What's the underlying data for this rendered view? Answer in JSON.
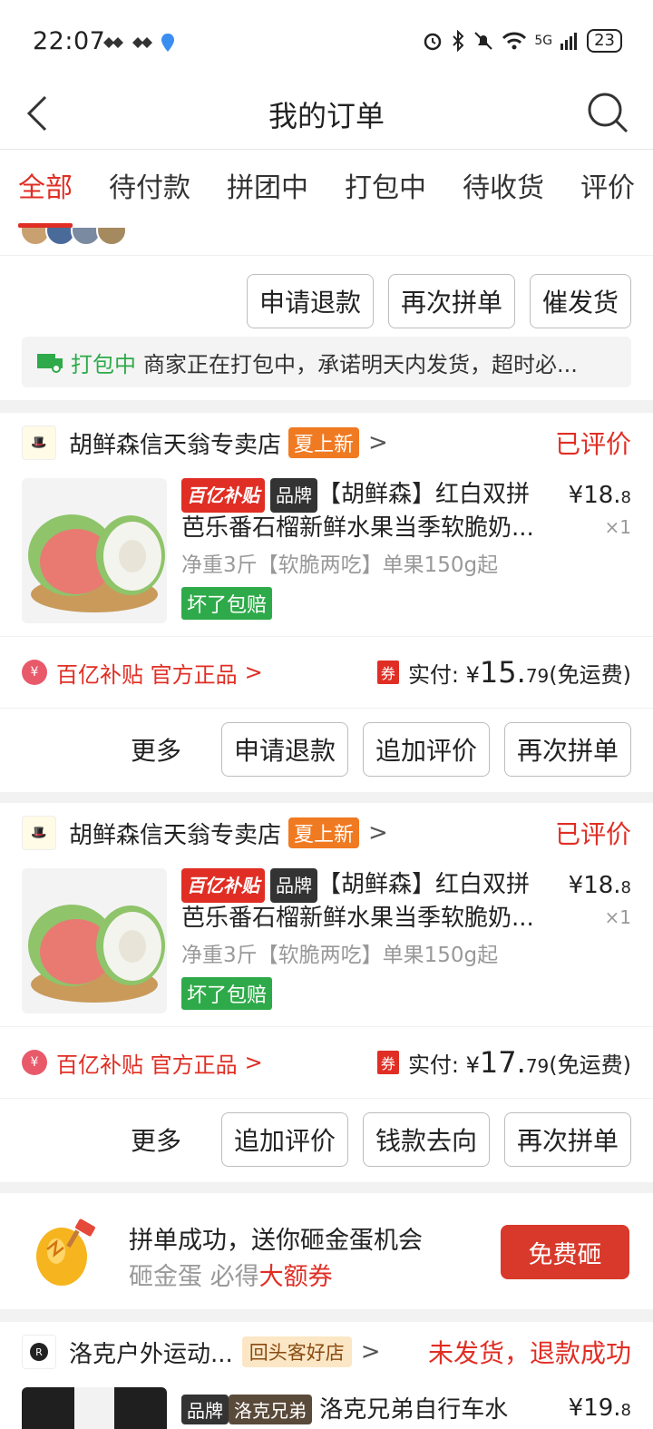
{
  "status_bar": {
    "time": "22:07",
    "network": "5G",
    "battery": "23"
  },
  "header": {
    "title": "我的订单"
  },
  "tabs": [
    "全部",
    "待付款",
    "拼团中",
    "打包中",
    "待收货",
    "评价"
  ],
  "order0": {
    "buttons": [
      "申请退款",
      "再次拼单",
      "催发货"
    ],
    "notice_status": "打包中",
    "notice_text": "商家正在打包中，承诺明天内发货，超时必..."
  },
  "order1": {
    "shop": "胡鲜森信天翁专卖店",
    "shop_tag": "夏上新",
    "status": "已评价",
    "badge_subsidy": "百亿补贴",
    "badge_brand": "品牌",
    "title": "【胡鲜森】红白双拼芭乐番石榴新鲜水果当季软脆奶...",
    "spec": "净重3斤【软脆两吃】单果150g起",
    "guarantee": "坏了包赔",
    "price_int": "¥18.",
    "price_dec": "8",
    "qty": "×1",
    "subsidy_text": "百亿补贴 官方正品",
    "coupon": "券",
    "paid_label": "实付: ¥",
    "paid_int": "15.",
    "paid_dec": "79",
    "shipping": "(免运费)",
    "more": "更多",
    "buttons": [
      "申请退款",
      "追加评价",
      "再次拼单"
    ]
  },
  "order2": {
    "shop": "胡鲜森信天翁专卖店",
    "shop_tag": "夏上新",
    "status": "已评价",
    "badge_subsidy": "百亿补贴",
    "badge_brand": "品牌",
    "title": "【胡鲜森】红白双拼芭乐番石榴新鲜水果当季软脆奶...",
    "spec": "净重3斤【软脆两吃】单果150g起",
    "guarantee": "坏了包赔",
    "price_int": "¥18.",
    "price_dec": "8",
    "qty": "×1",
    "subsidy_text": "百亿补贴 官方正品",
    "coupon": "券",
    "paid_label": "实付: ¥",
    "paid_int": "17.",
    "paid_dec": "79",
    "shipping": "(免运费)",
    "more": "更多",
    "buttons": [
      "追加评价",
      "钱款去向",
      "再次拼单"
    ]
  },
  "egg_promo": {
    "line1": "拼单成功，送你砸金蛋机会",
    "line2_gray": "砸金蛋 必得",
    "line2_red": "大额券",
    "button": "免费砸"
  },
  "order3": {
    "shop": "洛克户外运动...",
    "shop_tag": "回头客好店",
    "status": "未发货，退款成功",
    "badge_brand": "品牌",
    "badge_brand_name": "洛克兄弟",
    "title": "洛克兄弟自行车水",
    "price_int": "¥19.",
    "price_dec": "8"
  },
  "colors": {
    "accent": "#e02e24",
    "green": "#2faa4a",
    "orange": "#f07a22"
  }
}
